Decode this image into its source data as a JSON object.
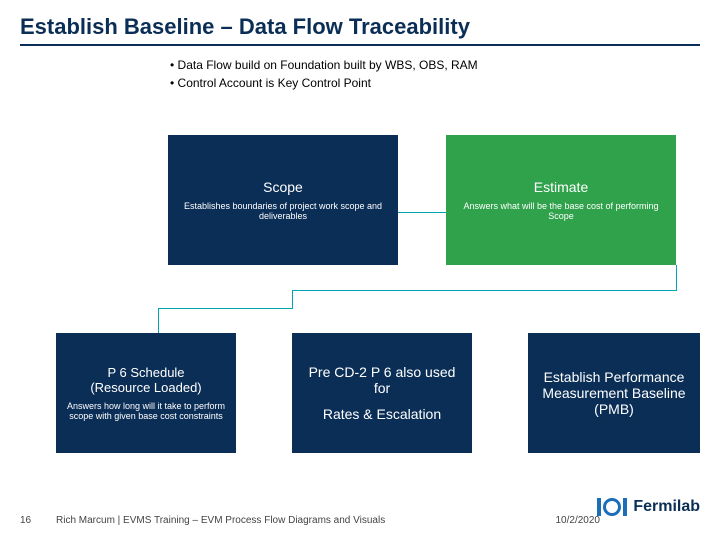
{
  "title": "Establish Baseline – Data Flow Traceability",
  "bullets": [
    "Data Flow build on Foundation built by WBS, OBS, RAM",
    "Control Account is Key Control Point"
  ],
  "boxes": {
    "scope": {
      "label": "Scope",
      "sub": "Establishes boundaries of project work scope and deliverables"
    },
    "estimate": {
      "label": "Estimate",
      "sub": "Answers what will be the base cost of performing Scope"
    },
    "p6": {
      "label1": "P 6 Schedule",
      "label2": "(Resource Loaded)",
      "sub": "Answers how long will it take to perform scope with given base cost constraints"
    },
    "preCd": {
      "label1": "Pre CD-2 P 6 also used for",
      "label2": "Rates & Escalation"
    },
    "pmb": {
      "label": "Establish Performance Measurement Baseline (PMB)"
    }
  },
  "footer": {
    "num": "16",
    "text": "Rich Marcum | EVMS Training – EVM Process Flow Diagrams and Visuals",
    "date": "10/2/2020",
    "logo": "Fermilab"
  }
}
